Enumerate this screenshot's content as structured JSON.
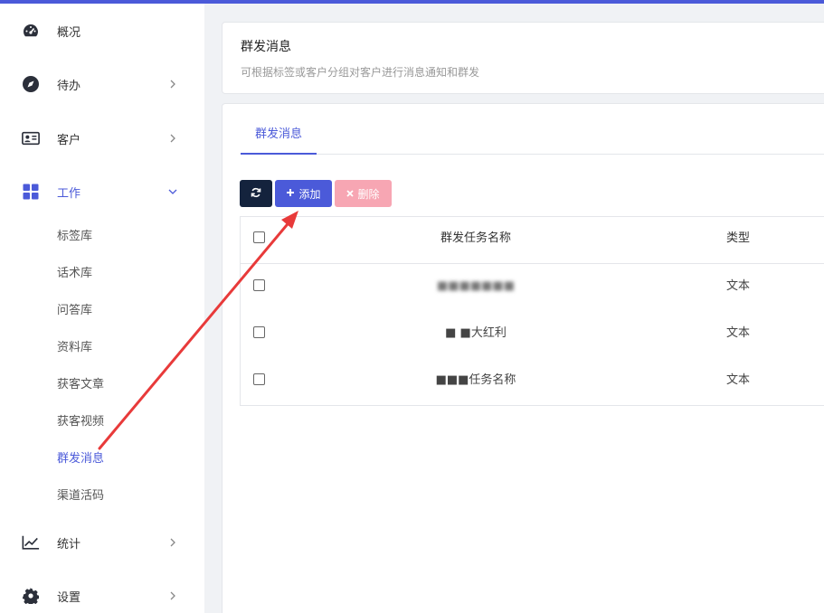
{
  "sidebar": {
    "items": [
      {
        "label": "概况",
        "icon": "dashboard-gauge-icon"
      },
      {
        "label": "待办",
        "icon": "compass-icon"
      },
      {
        "label": "客户",
        "icon": "contact-card-icon"
      },
      {
        "label": "工作",
        "icon": "grid-icon"
      },
      {
        "label": "统计",
        "icon": "line-chart-icon"
      },
      {
        "label": "设置",
        "icon": "gear-icon"
      }
    ],
    "work_subitems": [
      "标签库",
      "话术库",
      "问答库",
      "资料库",
      "获客文章",
      "获客视频",
      "群发消息",
      "渠道活码"
    ]
  },
  "header": {
    "title": "群发消息",
    "subtitle": "可根据标签或客户分组对客户进行消息通知和群发"
  },
  "tabs": [
    {
      "label": "群发消息"
    }
  ],
  "toolbar": {
    "add_label": "添加",
    "delete_label": "删除"
  },
  "table": {
    "columns": [
      "群发任务名称",
      "类型"
    ],
    "rows": [
      {
        "name": "■■■■■■■",
        "type": "文本"
      },
      {
        "name": "■ ■大红利",
        "type": "文本"
      },
      {
        "name": "■■■任务名称",
        "type": "文本"
      }
    ]
  },
  "colors": {
    "accent": "#4b5ad9",
    "refresh_button": "#14233d",
    "delete_button": "#f7a6b3",
    "annotation_arrow": "#e83a3a"
  }
}
